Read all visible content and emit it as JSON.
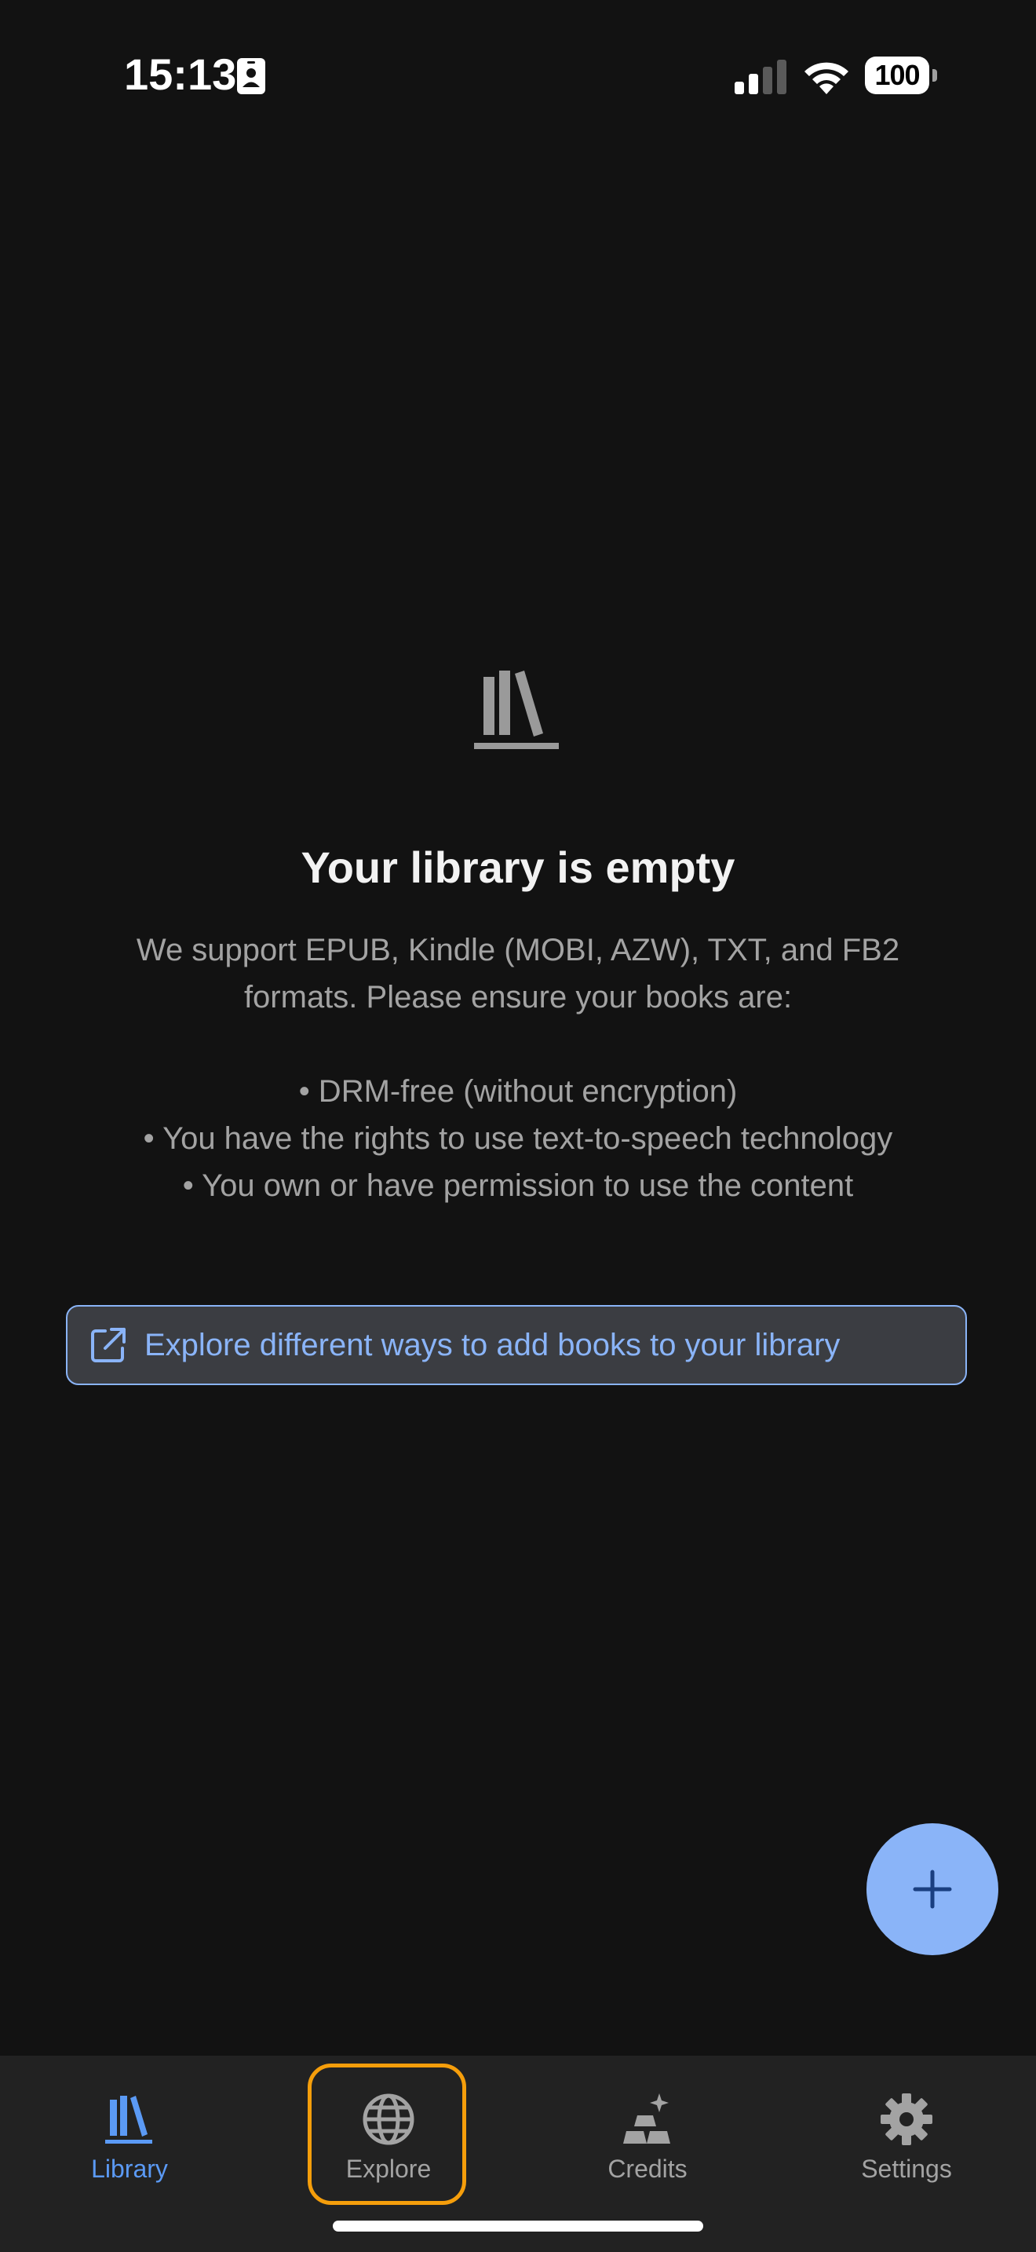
{
  "status_bar": {
    "time": "15:13",
    "battery": "100",
    "icons": [
      "id-card-icon",
      "cellular-signal-icon",
      "wifi-icon",
      "battery-icon"
    ]
  },
  "empty_state": {
    "icon": "books-icon",
    "title": "Your library is empty",
    "description_lines": [
      "We support EPUB, Kindle (MOBI, AZW), TXT, and FB2",
      "formats. Please ensure your books are:"
    ],
    "requirements": [
      "• DRM-free (without encryption)",
      "• You have the rights to use text-to-speech technology",
      "• You own or have permission to use the content"
    ]
  },
  "explore_link": {
    "icon": "external-link-icon",
    "label": "Explore different ways to add books to your library"
  },
  "fab": {
    "icon": "plus-icon"
  },
  "bottom_nav": {
    "items": [
      {
        "label": "Library",
        "icon": "library-icon",
        "active": true
      },
      {
        "label": "Explore",
        "icon": "globe-icon",
        "active": false
      },
      {
        "label": "Credits",
        "icon": "credits-icon",
        "active": false
      },
      {
        "label": "Settings",
        "icon": "gear-icon",
        "active": false
      }
    ]
  },
  "colors": {
    "background": "#121212",
    "accent": "#8ab4f8",
    "active_nav": "#5b9af5",
    "muted_text": "#a3a3a3",
    "nav_background": "#222222",
    "highlight": "#f59e0b"
  }
}
